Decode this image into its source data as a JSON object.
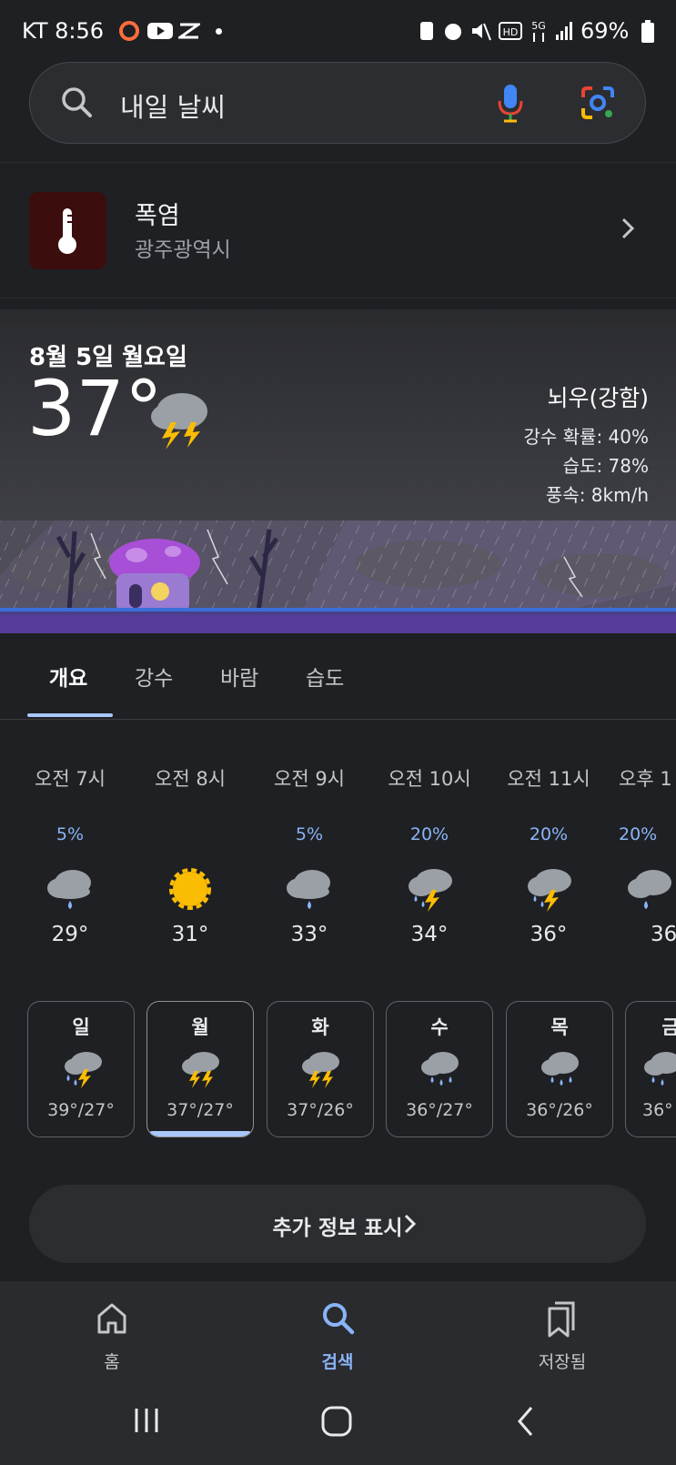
{
  "status_bar": {
    "carrier_time": "KT 8:56",
    "battery": "69%"
  },
  "search": {
    "query": "내일 날씨"
  },
  "alert": {
    "title": "폭염",
    "location": "광주광역시"
  },
  "weather": {
    "date": "8월 5일 월요일",
    "temperature": "37°",
    "condition": "뇌우(강함)",
    "precip": "강수 확률: 40%",
    "humidity": "습도: 78%",
    "wind": "풍속: 8km/h"
  },
  "tabs": [
    "개요",
    "강수",
    "바람",
    "습도"
  ],
  "hourly": [
    {
      "time": "오전 7시",
      "prob": "5%",
      "icon": "rain-icon",
      "temp": "29°"
    },
    {
      "time": "오전 8시",
      "prob": "",
      "icon": "sun-icon",
      "temp": "31°"
    },
    {
      "time": "오전 9시",
      "prob": "5%",
      "icon": "rain-icon",
      "temp": "33°"
    },
    {
      "time": "오전 10시",
      "prob": "20%",
      "icon": "thunderstorm-icon",
      "temp": "34°"
    },
    {
      "time": "오전 11시",
      "prob": "20%",
      "icon": "thunderstorm-icon",
      "temp": "36°"
    },
    {
      "time": "오후 1",
      "prob": "20%",
      "icon": "rain-icon",
      "temp": "36"
    }
  ],
  "daily": [
    {
      "day": "일",
      "icon": "thunderstorm-icon",
      "temps": "39°/27°"
    },
    {
      "day": "월",
      "icon": "thunderstorm-icon",
      "temps": "37°/27°"
    },
    {
      "day": "화",
      "icon": "thunderstorm-icon",
      "temps": "37°/26°"
    },
    {
      "day": "수",
      "icon": "rain-icon",
      "temps": "36°/27°"
    },
    {
      "day": "목",
      "icon": "rain-icon",
      "temps": "36°/26°"
    },
    {
      "day": "금",
      "icon": "rain-icon",
      "temps": "36°"
    }
  ],
  "more_info": "추가 정보 표시",
  "bottom_nav": {
    "home": "홈",
    "search": "검색",
    "saved": "저장됨"
  },
  "colors": {
    "accent": "#8ab4f8",
    "background": "#1f2023"
  }
}
